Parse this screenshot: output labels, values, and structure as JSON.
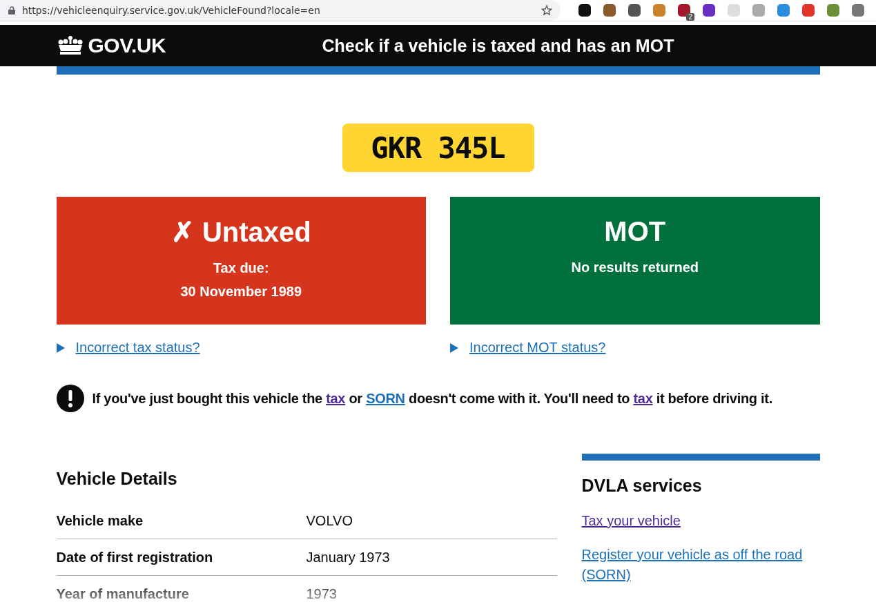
{
  "browser": {
    "url": "https://vehicleenquiry.service.gov.uk/VehicleFound?locale=en",
    "extensions": [
      {
        "color": "#111111"
      },
      {
        "color": "#8a5a2b"
      },
      {
        "color": "#555555"
      },
      {
        "color": "#c9832d"
      },
      {
        "color": "#a3182b",
        "badge": "2"
      },
      {
        "color": "#6a2fc0"
      },
      {
        "color": "#dddddd"
      },
      {
        "color": "#aaaaaa"
      },
      {
        "color": "#2a8de0"
      },
      {
        "color": "#e0352b"
      },
      {
        "color": "#6d8f3a"
      },
      {
        "color": "#777777"
      }
    ]
  },
  "header": {
    "logo": "GOV.UK",
    "service": "Check if a vehicle is taxed and has an MOT"
  },
  "plate": "GKR 345L",
  "status_cards": [
    {
      "title": "✗ Untaxed",
      "color": "#d4351c",
      "lines": [
        "Tax due:",
        "30 November 1989"
      ],
      "details": "Incorrect tax status?"
    },
    {
      "title": "MOT",
      "color": "#00703c",
      "lines": [
        "No results returned"
      ],
      "details": "Incorrect MOT status?"
    }
  ],
  "warning_parts": [
    {
      "kind": "text",
      "text": "If you've just bought this vehicle the"
    },
    {
      "kind": "link",
      "text": "tax",
      "visited": true
    },
    {
      "kind": "text",
      "text": "or"
    },
    {
      "kind": "link",
      "text": "SORN",
      "visited": false
    },
    {
      "kind": "text",
      "text": "doesn't come with it. You'll need to"
    },
    {
      "kind": "link",
      "text": "tax",
      "visited": true
    },
    {
      "kind": "text",
      "text": "it before driving it."
    }
  ],
  "vehicle_details": {
    "heading": "Vehicle Details",
    "rows": [
      {
        "label": "Vehicle make",
        "value": "VOLVO"
      },
      {
        "label": "Date of first registration",
        "value": "January 1973"
      },
      {
        "label": "Year of manufacture",
        "value": "1973"
      }
    ]
  },
  "sidebar": {
    "heading": "DVLA services",
    "links": [
      {
        "text": "Tax your vehicle",
        "visited": true
      },
      {
        "text": "Register your vehicle as off the road (SORN)",
        "visited": false
      }
    ]
  }
}
